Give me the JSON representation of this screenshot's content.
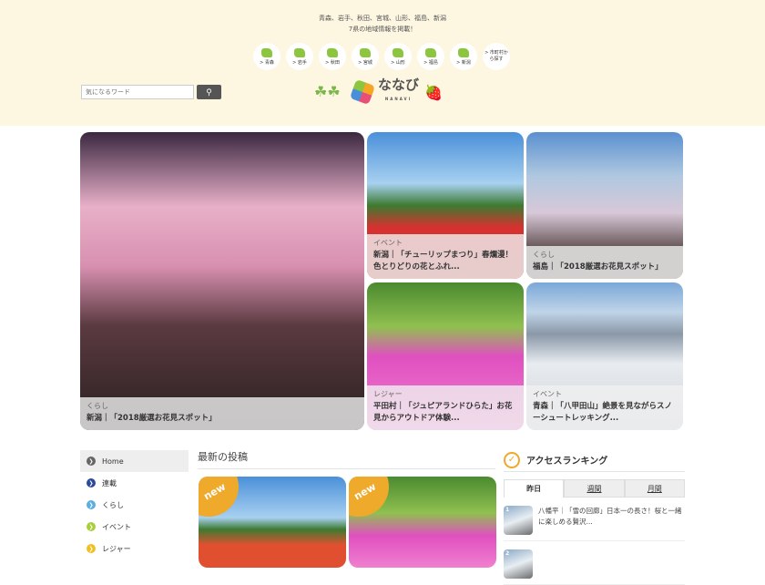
{
  "header": {
    "tagline1": "青森、岩手、秋田、宮城、山形、福島、新潟",
    "tagline2": "7県の地域情報を掲載！",
    "prefectures": [
      "> 青森",
      "> 岩手",
      "> 秋田",
      "> 宮城",
      "> 山形",
      "> 福島",
      "> 新潟"
    ],
    "more": "> 市町村から探す",
    "logo_text": "ななび",
    "logo_sub": "NANAVI",
    "search_placeholder": "気になるワード",
    "search_icon": "magnifier-icon"
  },
  "hero": [
    {
      "category": "くらし",
      "title": "新潟｜「2018厳選お花見スポット」"
    },
    {
      "category": "イベント",
      "title": "新潟｜「チューリップまつり」春爛漫！色とりどりの花とふれ..."
    },
    {
      "category": "くらし",
      "title": "福島｜「2018厳選お花見スポット」"
    },
    {
      "category": "レジャー",
      "title": "平田村｜「ジュピアランドひらた」お花見からアウトドア体験..."
    },
    {
      "category": "イベント",
      "title": "青森｜「八甲田山」絶景を見ながらスノーシュートレッキング..."
    }
  ],
  "sidebar": [
    {
      "label": "Home",
      "color": "#666666"
    },
    {
      "label": "連載",
      "color": "#2a4a9a"
    },
    {
      "label": "くらし",
      "color": "#5aaee0"
    },
    {
      "label": "イベント",
      "color": "#a8cf3a"
    },
    {
      "label": "レジャー",
      "color": "#f0c020"
    }
  ],
  "latest": {
    "heading": "最新の投稿",
    "badge": "new"
  },
  "ranking": {
    "heading": "アクセスランキング",
    "check": "CHECK",
    "tabs": [
      "昨日",
      "週間",
      "月間"
    ],
    "items": [
      {
        "rank": "1",
        "title": "八幡平｜「雪の回廊」日本一の長さ！桜と一緒に楽しめる贅沢..."
      },
      {
        "rank": "2",
        "title": ""
      }
    ]
  }
}
